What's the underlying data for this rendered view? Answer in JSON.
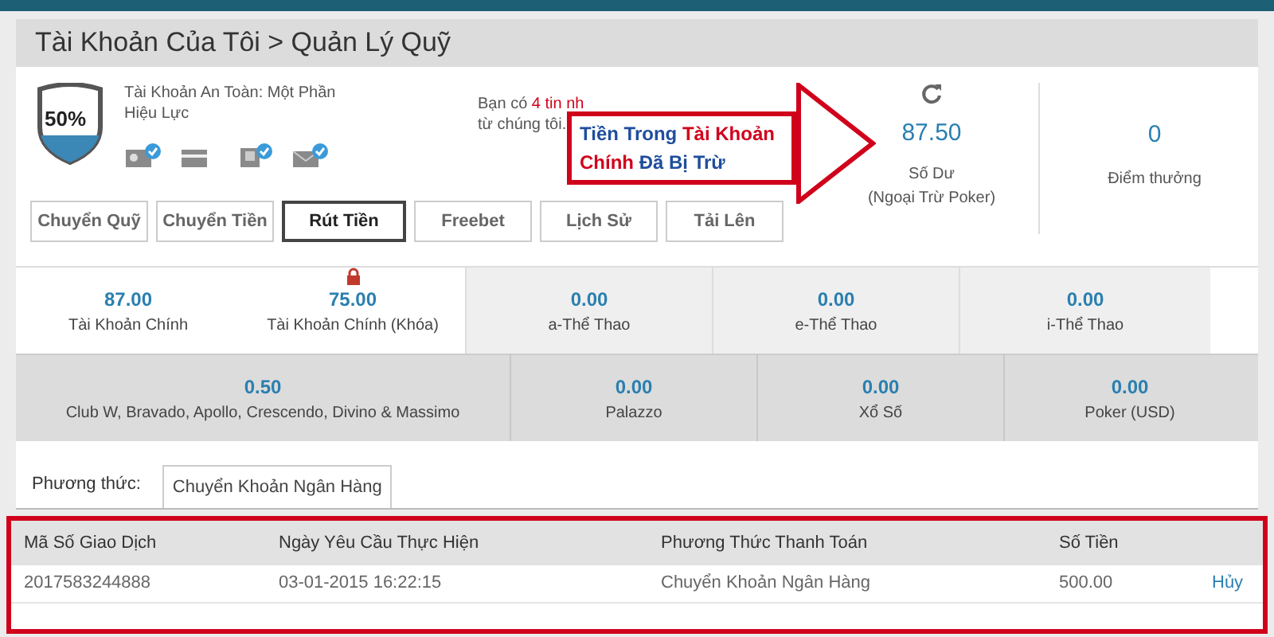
{
  "breadcrumb": "Tài Khoản Của Tôi > Quản Lý Quỹ",
  "security": {
    "percent": "50%",
    "label": "Tài Khoản An Toàn: Một Phần Hiệu Lực",
    "badges": [
      {
        "kind": "id",
        "verified": true
      },
      {
        "kind": "card",
        "verified": false
      },
      {
        "kind": "phone",
        "verified": true
      },
      {
        "kind": "mail",
        "verified": true
      }
    ]
  },
  "messages": {
    "prefix": "Bạn có ",
    "highlight": "4 tin nh",
    "line2": "từ chúng tôi."
  },
  "callout": {
    "parts": [
      {
        "text": "Tiền Trong ",
        "emphasis": false
      },
      {
        "text": "Tài Khoản",
        "emphasis": true
      },
      {
        "text": "Chính",
        "emphasis": true
      },
      {
        "text": " Đã Bị Trừ",
        "emphasis": false
      }
    ]
  },
  "balance": {
    "value": "87.50",
    "label": "Số Dư",
    "sublabel": "(Ngoại Trừ Poker)"
  },
  "points": {
    "value": "0",
    "label": "Điểm thưởng"
  },
  "tabs": [
    {
      "label": "Chuyển Quỹ",
      "selected": false
    },
    {
      "label": "Chuyển Tiền",
      "selected": false
    },
    {
      "label": "Rút Tiền",
      "selected": true
    },
    {
      "label": "Freebet",
      "selected": false
    },
    {
      "label": "Lịch Sử",
      "selected": false
    },
    {
      "label": "Tải Lên",
      "selected": false
    }
  ],
  "wallets_row1": [
    {
      "value": "87.00",
      "label": "Tài Khoản Chính",
      "locked": false,
      "shaded": false
    },
    {
      "value": "75.00",
      "label": "Tài Khoản Chính (Khóa)",
      "locked": true,
      "shaded": false
    },
    {
      "value": "0.00",
      "label": "a-Thể Thao",
      "locked": false,
      "shaded": true
    },
    {
      "value": "0.00",
      "label": "e-Thể Thao",
      "locked": false,
      "shaded": true
    },
    {
      "value": "0.00",
      "label": "i-Thể Thao",
      "locked": false,
      "shaded": true
    }
  ],
  "wallets_row2": [
    {
      "value": "0.50",
      "label": "Club W, Bravado, Apollo, Crescendo, Divino & Massimo"
    },
    {
      "value": "0.00",
      "label": "Palazzo"
    },
    {
      "value": "0.00",
      "label": "Xổ Số"
    },
    {
      "value": "0.00",
      "label": "Poker (USD)"
    }
  ],
  "method": {
    "label": "Phương thức:",
    "value": "Chuyển Khoản Ngân Hàng"
  },
  "table": {
    "columns": [
      "Mã Số Giao Dịch",
      "Ngày Yêu Cầu Thực Hiện",
      "Phương Thức Thanh Toán",
      "Số Tiền"
    ],
    "rows": [
      {
        "cells": [
          "2017583244888",
          "03-01-2015 16:22:15",
          "Chuyển Khoản Ngân Hàng",
          "500.00"
        ],
        "action": "Hủy"
      }
    ]
  }
}
